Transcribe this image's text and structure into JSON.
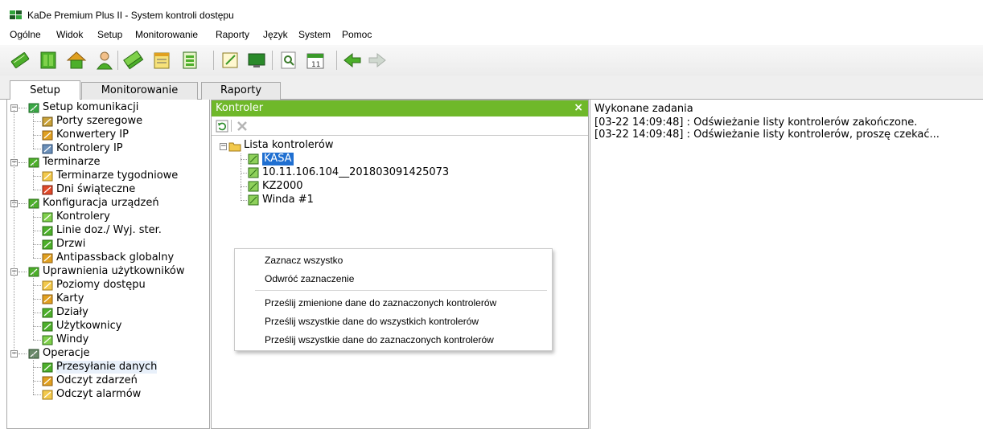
{
  "window": {
    "title": "KaDe Premium Plus II - System kontroli dostępu"
  },
  "menu": [
    "Ogólne",
    "Widok",
    "Setup",
    "Monitorowanie",
    "Raporty",
    "Język",
    "System",
    "Pomoc"
  ],
  "toolbar": {
    "icons": [
      "keycard-icon",
      "door-icon",
      "house-icon",
      "user-icon",
      "keycards-icon",
      "calendar-icon",
      "schedule-icon",
      "notepad-icon",
      "monitor-icon",
      "search-icon",
      "calendar-11-icon",
      "back-arrow-icon",
      "forward-arrow-icon"
    ]
  },
  "tabs": [
    "Setup",
    "Monitorowanie",
    "Raporty"
  ],
  "active_tab": "Setup",
  "tree": [
    {
      "label": "Setup komunikacji",
      "level": 0,
      "icon": "globe-icon"
    },
    {
      "label": "Porty szeregowe",
      "level": 1,
      "icon": "serial-port-icon"
    },
    {
      "label": "Konwertery IP",
      "level": 1,
      "icon": "network-icon"
    },
    {
      "label": "Kontrolery IP",
      "level": 1,
      "icon": "computer-icon"
    },
    {
      "label": "Terminarze",
      "level": 0,
      "icon": "calendar-icon"
    },
    {
      "label": "Terminarze tygodniowe",
      "level": 1,
      "icon": "weekly-calendar-icon"
    },
    {
      "label": "Dni świąteczne",
      "level": 1,
      "icon": "holiday-icon"
    },
    {
      "label": "Konfiguracja urządzeń",
      "level": 0,
      "icon": "devices-icon"
    },
    {
      "label": "Kontrolery",
      "level": 1,
      "icon": "controller-icon"
    },
    {
      "label": "Linie doz./ Wyj. ster.",
      "level": 1,
      "icon": "lines-icon"
    },
    {
      "label": "Drzwi",
      "level": 1,
      "icon": "door-icon"
    },
    {
      "label": "Antipassback globalny",
      "level": 1,
      "icon": "antipassback-icon"
    },
    {
      "label": "Uprawnienia użytkowników",
      "level": 0,
      "icon": "users-icon"
    },
    {
      "label": "Poziomy dostępu",
      "level": 1,
      "icon": "access-levels-icon"
    },
    {
      "label": "Karty",
      "level": 1,
      "icon": "card-icon"
    },
    {
      "label": "Działy",
      "level": 1,
      "icon": "departments-icon"
    },
    {
      "label": "Użytkownicy",
      "level": 1,
      "icon": "user-icon"
    },
    {
      "label": "Windy",
      "level": 1,
      "icon": "elevator-icon"
    },
    {
      "label": "Operacje",
      "level": 0,
      "icon": "operations-icon"
    },
    {
      "label": "Przesyłanie danych",
      "level": 1,
      "icon": "data-transfer-icon",
      "selected": true
    },
    {
      "label": "Odczyt zdarzeń",
      "level": 1,
      "icon": "events-icon"
    },
    {
      "label": "Odczyt alarmów",
      "level": 1,
      "icon": "alarms-icon"
    }
  ],
  "kontroler_panel": {
    "title": "Kontroler",
    "close": "×",
    "root": "Lista kontrolerów",
    "items": [
      "KASA",
      "10.11.106.104__201803091425073",
      "KZ2000",
      "Winda #1"
    ],
    "selected_item": "KASA"
  },
  "context_menu": [
    "Zaznacz wszystko",
    "Odwróć zaznaczenie",
    "Prześlij zmienione dane do zaznaczonych kontrolerów",
    "Prześlij wszystkie dane do wszystkich kontrolerów",
    "Prześlij wszystkie dane do zaznaczonych kontrolerów"
  ],
  "tasks_panel": {
    "title": "Wykonane zadania",
    "lines": [
      "[03-22 14:09:48] : Odświeżanie listy kontrolerów zakończone.",
      "[03-22 14:09:48] : Odświeżanie listy kontrolerów, proszę czekać..."
    ]
  },
  "colors": {
    "panel_header": "#6fb82a",
    "selection": "#1f6fd1",
    "app_icon_green": "#2fa43a",
    "app_icon_dark": "#1e5a26"
  }
}
